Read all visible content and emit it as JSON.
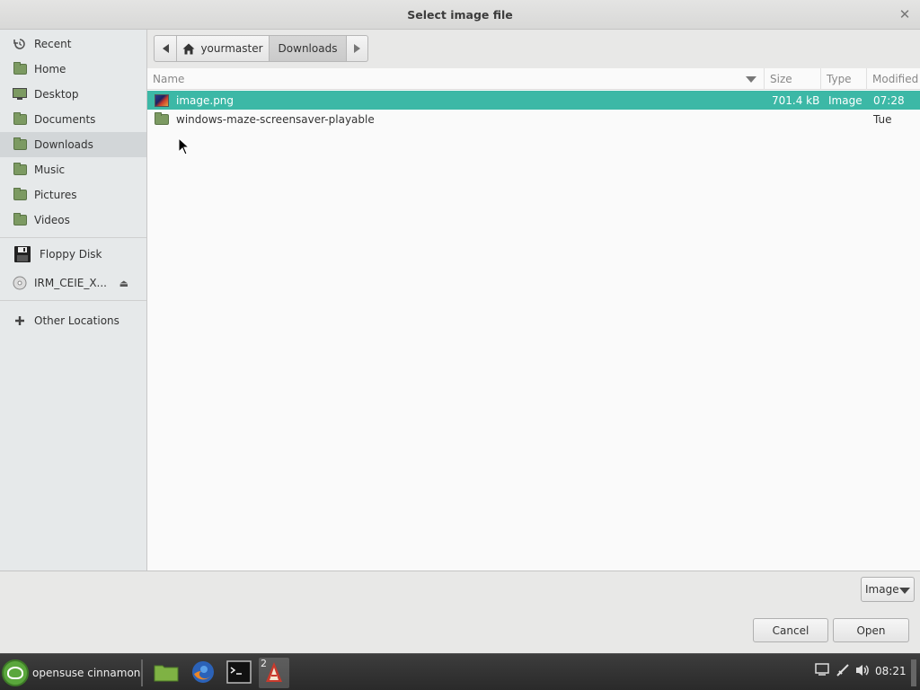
{
  "dialog": {
    "title": "Select image file"
  },
  "sidebar": {
    "places": [
      {
        "label": "Recent",
        "icon": "recent-icon"
      },
      {
        "label": "Home",
        "icon": "home-folder-icon"
      },
      {
        "label": "Desktop",
        "icon": "desktop-icon"
      },
      {
        "label": "Documents",
        "icon": "documents-folder-icon"
      },
      {
        "label": "Downloads",
        "icon": "downloads-folder-icon",
        "active": true
      },
      {
        "label": "Music",
        "icon": "music-folder-icon"
      },
      {
        "label": "Pictures",
        "icon": "pictures-folder-icon"
      },
      {
        "label": "Videos",
        "icon": "videos-folder-icon"
      }
    ],
    "devices": [
      {
        "label": "Floppy Disk",
        "icon": "floppy-disk-icon"
      },
      {
        "label": "IRM_CEIE_X...",
        "icon": "optical-disc-icon"
      }
    ],
    "other": {
      "label": "Other Locations",
      "icon": "plus-icon"
    }
  },
  "pathbar": {
    "home": "yourmaster",
    "current": "Downloads"
  },
  "columns": {
    "name": "Name",
    "size": "Size",
    "type": "Type",
    "modified": "Modified"
  },
  "files": [
    {
      "name": "image.png",
      "size": "701.4 kB",
      "type": "Image",
      "modified": "07:28",
      "selected": true
    },
    {
      "name": "windows-maze-screensaver-playable",
      "size": "",
      "type": "",
      "modified": "Tue",
      "selected": false
    }
  ],
  "filter": {
    "selected": "Image"
  },
  "buttons": {
    "cancel": "Cancel",
    "open": "Open"
  },
  "taskbar": {
    "menu_label": "opensuse cinnamon",
    "window_count": "2",
    "clock": "08:21"
  },
  "colors": {
    "selection": "#3cb8a6",
    "folder": "#7c9a62"
  }
}
